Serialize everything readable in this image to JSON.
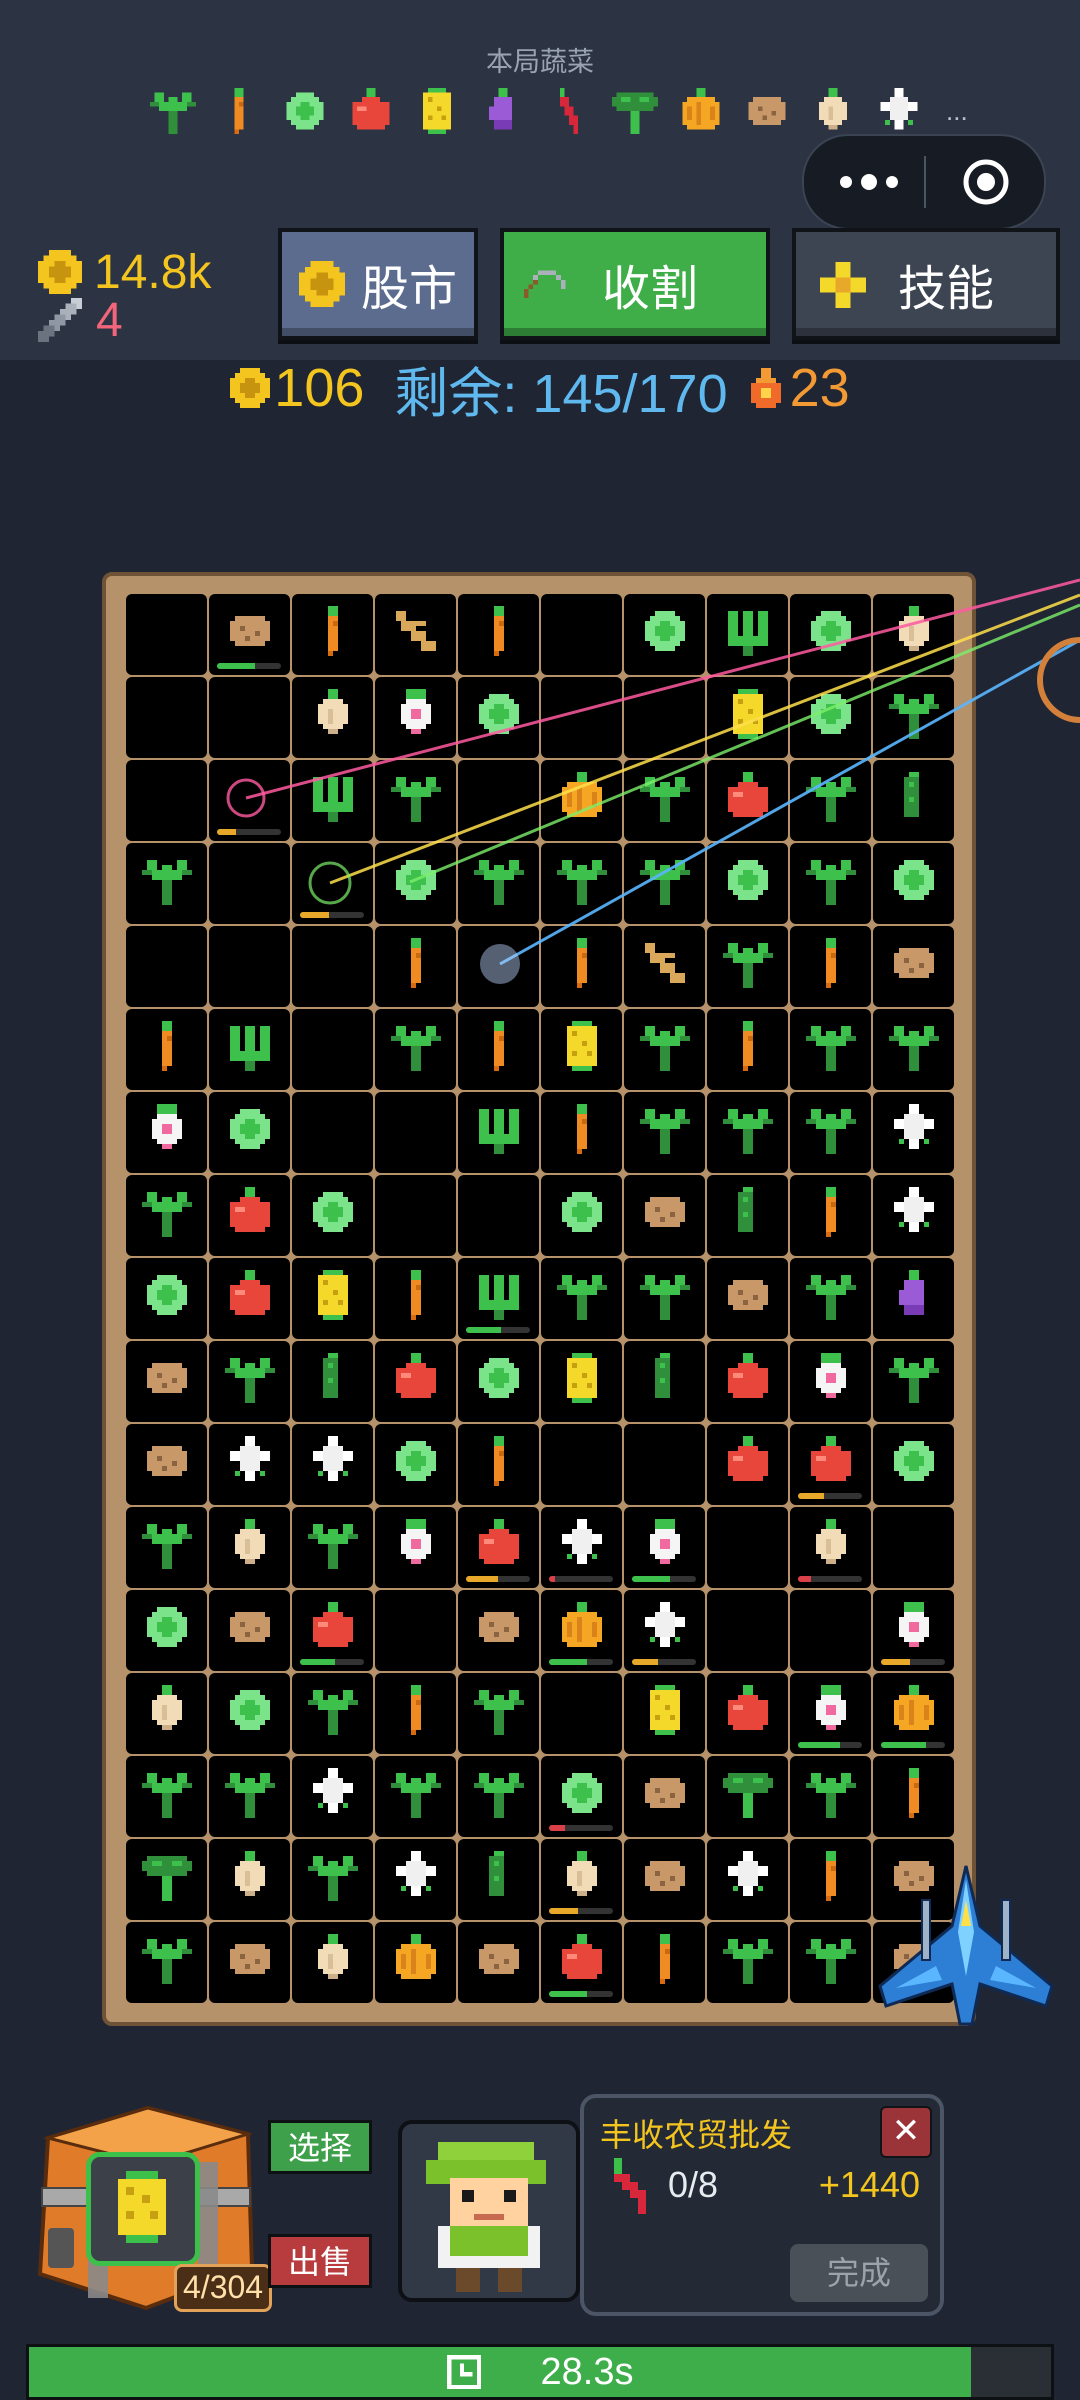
{
  "header": {
    "veg_title": "本局蔬菜",
    "veg_list": [
      "sprout",
      "carrot",
      "cabbage",
      "tomato",
      "corn",
      "eggplant",
      "pepper",
      "broccoli",
      "pumpkin",
      "potato",
      "onion",
      "cauliflower"
    ],
    "more": "..."
  },
  "stats": {
    "coins": "14.8k",
    "level": "4"
  },
  "toolbar": {
    "stock_label": "股市",
    "harvest_label": "收割",
    "skill_label": "技能"
  },
  "status": {
    "gold": "106",
    "remaining": "剩余: 145/170",
    "fire": "23"
  },
  "grid": [
    [
      "",
      "potato",
      "carrot",
      "ginger",
      "carrot",
      "",
      "cabbage",
      "trident",
      "cabbage",
      "onion"
    ],
    [
      "",
      "",
      "onion",
      "radish",
      "cabbage",
      "",
      "",
      "corn",
      "cabbage",
      "sprout"
    ],
    [
      "",
      "",
      "trident",
      "sprout",
      "",
      "pumpkin",
      "sprout",
      "tomato",
      "sprout",
      "cucumber"
    ],
    [
      "sprout",
      "",
      "",
      "cabbage",
      "sprout",
      "sprout",
      "sprout",
      "cabbage",
      "sprout",
      "cabbage"
    ],
    [
      "",
      "",
      "",
      "carrot",
      "",
      "carrot",
      "ginger",
      "sprout",
      "carrot",
      "potato"
    ],
    [
      "carrot",
      "trident",
      "",
      "sprout",
      "carrot",
      "corn",
      "sprout",
      "carrot",
      "sprout",
      "sprout"
    ],
    [
      "radish",
      "cabbage",
      "",
      "",
      "trident",
      "carrot",
      "sprout",
      "sprout",
      "sprout",
      "cauliflower"
    ],
    [
      "sprout",
      "tomato",
      "cabbage",
      "",
      "",
      "cabbage",
      "potato",
      "cucumber",
      "carrot",
      "cauliflower"
    ],
    [
      "cabbage",
      "tomato",
      "corn",
      "carrot",
      "trident",
      "sprout",
      "sprout",
      "potato",
      "sprout",
      "eggplant"
    ],
    [
      "potato",
      "sprout",
      "cucumber",
      "tomato",
      "cabbage",
      "corn",
      "cucumber",
      "tomato",
      "radish",
      "sprout"
    ],
    [
      "potato",
      "cauliflower",
      "cauliflower",
      "cabbage",
      "carrot",
      "",
      "",
      "tomato",
      "tomato",
      "cabbage"
    ],
    [
      "sprout",
      "onion",
      "sprout",
      "radish",
      "tomato",
      "cauliflower",
      "radish",
      "",
      "onion",
      ""
    ],
    [
      "cabbage",
      "potato",
      "tomato",
      "",
      "potato",
      "pumpkin",
      "cauliflower",
      "",
      "",
      "radish"
    ],
    [
      "onion",
      "cabbage",
      "sprout",
      "carrot",
      "sprout",
      "",
      "corn",
      "tomato",
      "radish",
      "pumpkin"
    ],
    [
      "sprout",
      "sprout",
      "cauliflower",
      "sprout",
      "sprout",
      "cabbage",
      "potato",
      "broccoli",
      "sprout",
      "carrot"
    ],
    [
      "broccoli",
      "onion",
      "sprout",
      "cauliflower",
      "cucumber",
      "onion",
      "potato",
      "cauliflower",
      "carrot",
      "potato"
    ],
    [
      "sprout",
      "potato",
      "onion",
      "pumpkin",
      "potato",
      "tomato",
      "carrot",
      "sprout",
      "sprout",
      "potato"
    ]
  ],
  "bars": [
    {
      "r": 0,
      "c": 1,
      "color": "#3ec04c",
      "pct": 0.6
    },
    {
      "r": 2,
      "c": 1,
      "color": "#e8a82a",
      "pct": 0.3
    },
    {
      "r": 3,
      "c": 2,
      "color": "#e8a82a",
      "pct": 0.45
    },
    {
      "r": 8,
      "c": 4,
      "color": "#3ec04c",
      "pct": 0.55
    },
    {
      "r": 10,
      "c": 8,
      "color": "#e8a82a",
      "pct": 0.4
    },
    {
      "r": 11,
      "c": 4,
      "color": "#e8a82a",
      "pct": 0.5
    },
    {
      "r": 11,
      "c": 5,
      "color": "#d94048",
      "pct": 0.1
    },
    {
      "r": 11,
      "c": 6,
      "color": "#3ec04c",
      "pct": 0.6
    },
    {
      "r": 11,
      "c": 8,
      "color": "#d94048",
      "pct": 0.2
    },
    {
      "r": 12,
      "c": 2,
      "color": "#3ec04c",
      "pct": 0.55
    },
    {
      "r": 12,
      "c": 5,
      "color": "#3ec04c",
      "pct": 0.6
    },
    {
      "r": 12,
      "c": 6,
      "color": "#e8a82a",
      "pct": 0.4
    },
    {
      "r": 12,
      "c": 9,
      "color": "#e8a82a",
      "pct": 0.45
    },
    {
      "r": 13,
      "c": 8,
      "color": "#3ec04c",
      "pct": 0.65
    },
    {
      "r": 13,
      "c": 9,
      "color": "#3ec04c",
      "pct": 0.7
    },
    {
      "r": 14,
      "c": 5,
      "color": "#d94048",
      "pct": 0.25
    },
    {
      "r": 15,
      "c": 5,
      "color": "#e8a82a",
      "pct": 0.45
    },
    {
      "r": 16,
      "c": 5,
      "color": "#3ec04c",
      "pct": 0.6
    }
  ],
  "inventory": {
    "count": "4/304",
    "select_label": "选择",
    "sell_label": "出售"
  },
  "order": {
    "title": "丰收农贸批发",
    "close": "✕",
    "progress": "0/8",
    "reward": "+1440",
    "done_label": "完成"
  },
  "timer": {
    "text": "28.3s",
    "progress": 0.922
  }
}
